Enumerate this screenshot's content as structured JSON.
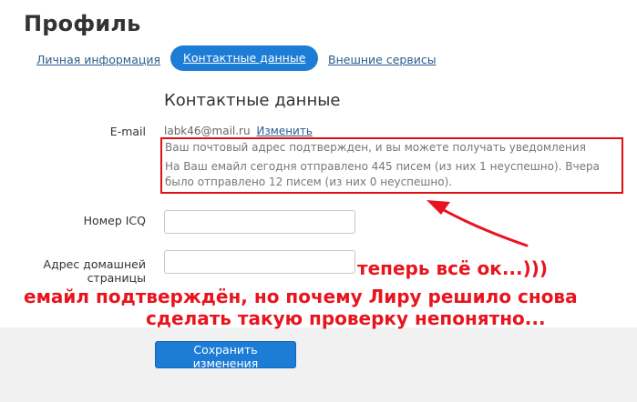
{
  "page": {
    "title": "Профиль"
  },
  "tabs": [
    {
      "label": "Личная информация"
    },
    {
      "label": "Контактные данные"
    },
    {
      "label": "Внешние сервисы"
    }
  ],
  "section": {
    "title": "Контактные данные"
  },
  "email": {
    "label": "E-mail",
    "value": "labk46@mail.ru",
    "change_link": "Изменить",
    "notice_line1": "Ваш почтовый адрес подтвержден, и вы можете получать уведомления",
    "notice_line2": "На Ваш емайл сегодня отправлено 445 писем (из них 1 неуспешно). Вчера",
    "notice_line3": "было отправлено 12 писем (из них 0 неуспешно)."
  },
  "icq": {
    "label": "Номер ICQ",
    "value": ""
  },
  "homepage": {
    "label_line1": "Адрес домашней",
    "label_line2": "страницы",
    "value": ""
  },
  "footer": {
    "save_label": "Сохранить изменения"
  },
  "annotations": {
    "line1": "теперь всё ок...)))",
    "line2": "емайл подтверждён, но почему Лиру решило снова",
    "line3": "сделать такую проверку непонятно..."
  },
  "colors": {
    "accent": "#1c7cd6",
    "annotation": "#e8141e",
    "link": "#2a5d8f"
  }
}
